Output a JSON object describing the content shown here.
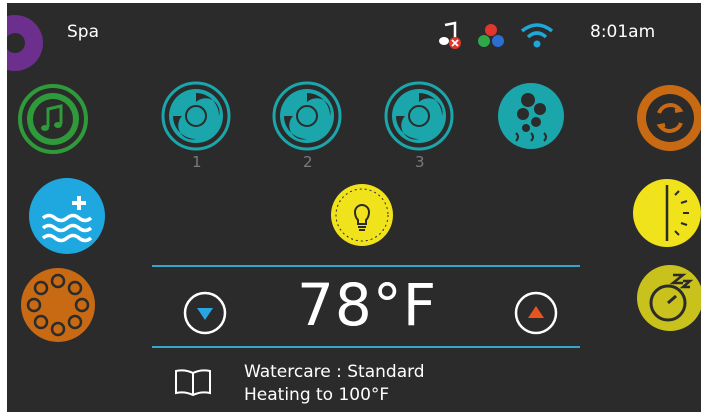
{
  "status_bar": {
    "title": "Spa",
    "time": "8:01am",
    "icons": [
      "music-muted-icon",
      "color-dots-icon",
      "wifi-icon"
    ]
  },
  "left_panel": {
    "items": [
      "audio-icon",
      "water-fill-icon",
      "filter-cycle-icon"
    ]
  },
  "pumps": [
    {
      "label": "1",
      "icon": "pump-jet-icon"
    },
    {
      "label": "2",
      "icon": "pump-jet-icon"
    },
    {
      "label": "3",
      "icon": "pump-jet-icon"
    },
    {
      "label": "",
      "icon": "blower-bubbles-icon"
    }
  ],
  "light": {
    "icon": "light-bulb-icon",
    "color": "#f0e21b"
  },
  "right_panel": {
    "items": [
      "inverse-mode-icon",
      "light-cycle-icon",
      "economy-sleep-icon"
    ]
  },
  "temperature": {
    "display": "78°F",
    "down_icon": "arrow-down-icon",
    "up_icon": "arrow-up-icon"
  },
  "info": {
    "watercare": "Watercare : Standard",
    "heating": "Heating to 100°F",
    "icon": "book-icon"
  },
  "colors": {
    "background": "#2b2b2b",
    "accent_teal": "#1aa6ab",
    "accent_blue": "#34a6c9",
    "yellow": "#f0e21b",
    "orange": "#c76a13",
    "green": "#2e9a3a",
    "purple": "#6d2f8e"
  }
}
